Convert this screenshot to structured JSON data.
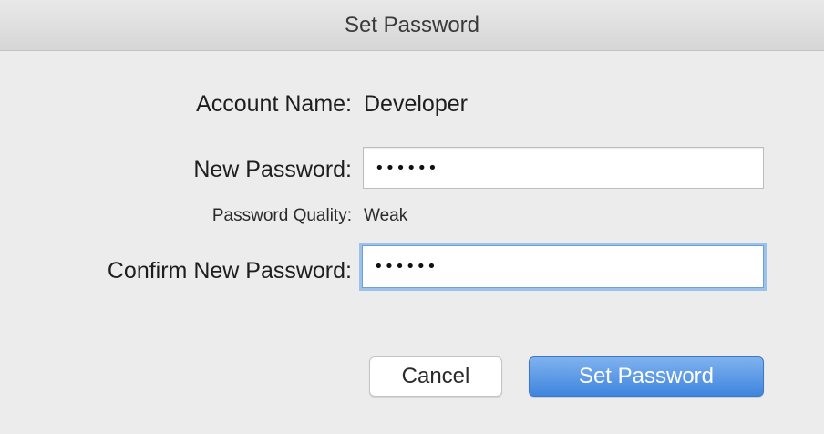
{
  "window": {
    "title": "Set Password"
  },
  "form": {
    "account_name_label": "Account Name:",
    "account_name_value": "Developer",
    "new_password_label": "New Password:",
    "new_password_value": "••••••",
    "quality_label": "Password Quality:",
    "quality_value": "Weak",
    "confirm_password_label": "Confirm New Password:",
    "confirm_password_value": "••••••"
  },
  "buttons": {
    "cancel_label": "Cancel",
    "set_password_label": "Set Password"
  },
  "colors": {
    "accent": "#4a8fe3",
    "focus_ring": "#9cc2ec"
  }
}
